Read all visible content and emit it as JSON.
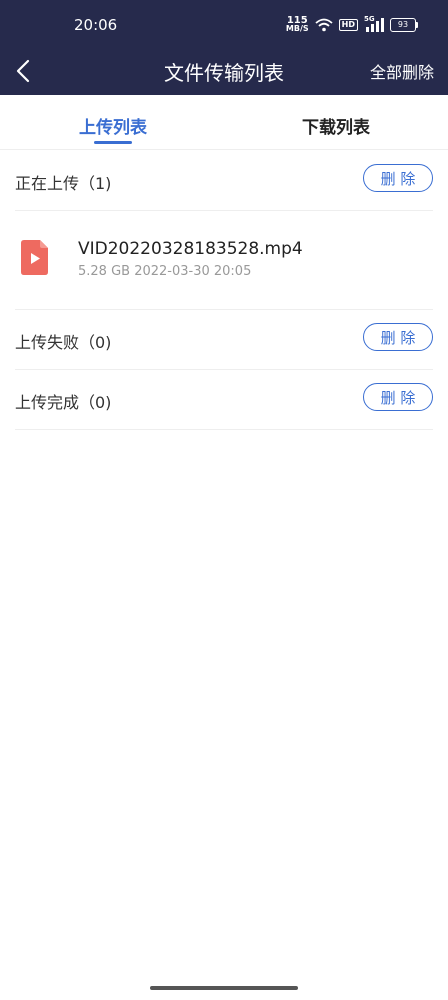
{
  "status_bar": {
    "time": "20:06",
    "net_speed": "115",
    "net_unit": "MB/S",
    "hd": "HD",
    "signal": "5G",
    "battery": "93"
  },
  "header": {
    "title": "文件传输列表",
    "delete_all": "全部删除"
  },
  "tabs": [
    {
      "label": "上传列表",
      "active": true
    },
    {
      "label": "下载列表",
      "active": false
    }
  ],
  "sections": {
    "uploading": {
      "label": "正在上传（1)",
      "delete": "删 除"
    },
    "failed": {
      "label": "上传失败（0)",
      "delete": "删 除"
    },
    "completed": {
      "label": "上传完成（0)",
      "delete": "删 除"
    }
  },
  "file": {
    "name": "VID20220328183528.mp4",
    "meta": "5.28 GB 2022-03-30 20:05",
    "icon": "video-file-icon"
  },
  "colors": {
    "header_bg": "#262a4c",
    "accent": "#3a6ed2",
    "file_icon": "#ee6a60"
  }
}
